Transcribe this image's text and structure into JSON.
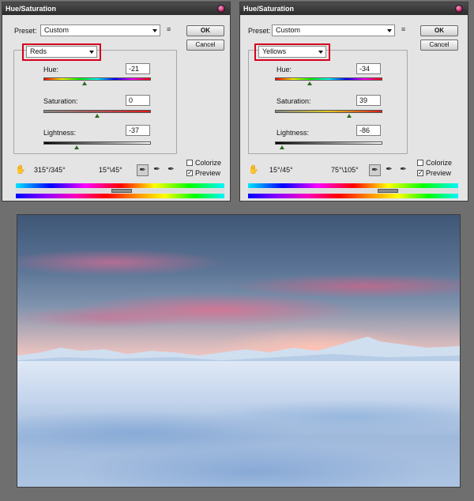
{
  "dialogs": [
    {
      "title": "Hue/Saturation",
      "preset_label": "Preset:",
      "preset_value": "Custom",
      "ok_label": "OK",
      "cancel_label": "Cancel",
      "channel": "Reds",
      "hue_label": "Hue:",
      "hue_value": "-21",
      "hue_slider_fraction": 0.44,
      "saturation_label": "Saturation:",
      "saturation_value": "0",
      "saturation_slider_fraction": 0.5,
      "lightness_label": "Lightness:",
      "lightness_value": "-37",
      "lightness_slider_fraction": 0.32,
      "range_left": "315°/345°",
      "range_right": "15°\\45°",
      "colorize_label": "Colorize",
      "colorize_checked": false,
      "preview_label": "Preview",
      "preview_checked": true
    },
    {
      "title": "Hue/Saturation",
      "preset_label": "Preset:",
      "preset_value": "Custom",
      "ok_label": "OK",
      "cancel_label": "Cancel",
      "channel": "Yellows",
      "hue_label": "Hue:",
      "hue_value": "-34",
      "hue_slider_fraction": 0.32,
      "saturation_label": "Saturation:",
      "saturation_value": "39",
      "saturation_slider_fraction": 0.69,
      "lightness_label": "Lightness:",
      "lightness_value": "-86",
      "lightness_slider_fraction": 0.07,
      "range_left": "15°/45°",
      "range_right": "75°\\105°",
      "colorize_label": "Colorize",
      "colorize_checked": false,
      "preview_label": "Preview",
      "preview_checked": true
    }
  ],
  "colors": {
    "highlight_box": "#d6001c",
    "titlebar": "#333333",
    "dialog_bg": "#e4e4e4"
  },
  "icons": {
    "menu": "list-menu-icon",
    "hand": "hand-scrubby-icon",
    "eyedropper": "eyedropper-icon",
    "eyedropper_plus": "eyedropper-plus-icon",
    "eyedropper_minus": "eyedropper-minus-icon"
  }
}
